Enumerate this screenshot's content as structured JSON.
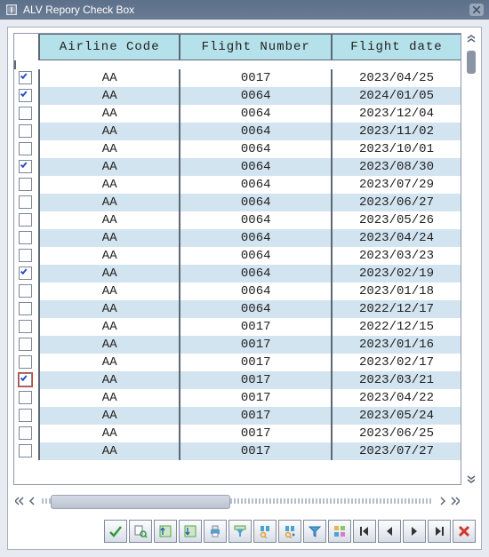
{
  "window": {
    "title": "ALV Repory Check Box"
  },
  "headers": {
    "airline": "Airline Code",
    "flight": "Flight Number",
    "date": "Flight date"
  },
  "rows": [
    {
      "checked": true,
      "focus": false,
      "airline": "AA",
      "flight": "0017",
      "date": "2023/04/25"
    },
    {
      "checked": true,
      "focus": false,
      "airline": "AA",
      "flight": "0064",
      "date": "2024/01/05"
    },
    {
      "checked": false,
      "focus": false,
      "airline": "AA",
      "flight": "0064",
      "date": "2023/12/04"
    },
    {
      "checked": false,
      "focus": false,
      "airline": "AA",
      "flight": "0064",
      "date": "2023/11/02"
    },
    {
      "checked": false,
      "focus": false,
      "airline": "AA",
      "flight": "0064",
      "date": "2023/10/01"
    },
    {
      "checked": true,
      "focus": false,
      "airline": "AA",
      "flight": "0064",
      "date": "2023/08/30"
    },
    {
      "checked": false,
      "focus": false,
      "airline": "AA",
      "flight": "0064",
      "date": "2023/07/29"
    },
    {
      "checked": false,
      "focus": false,
      "airline": "AA",
      "flight": "0064",
      "date": "2023/06/27"
    },
    {
      "checked": false,
      "focus": false,
      "airline": "AA",
      "flight": "0064",
      "date": "2023/05/26"
    },
    {
      "checked": false,
      "focus": false,
      "airline": "AA",
      "flight": "0064",
      "date": "2023/04/24"
    },
    {
      "checked": false,
      "focus": false,
      "airline": "AA",
      "flight": "0064",
      "date": "2023/03/23"
    },
    {
      "checked": true,
      "focus": false,
      "airline": "AA",
      "flight": "0064",
      "date": "2023/02/19"
    },
    {
      "checked": false,
      "focus": false,
      "airline": "AA",
      "flight": "0064",
      "date": "2023/01/18"
    },
    {
      "checked": false,
      "focus": false,
      "airline": "AA",
      "flight": "0064",
      "date": "2022/12/17"
    },
    {
      "checked": false,
      "focus": false,
      "airline": "AA",
      "flight": "0017",
      "date": "2022/12/15"
    },
    {
      "checked": false,
      "focus": false,
      "airline": "AA",
      "flight": "0017",
      "date": "2023/01/16"
    },
    {
      "checked": false,
      "focus": false,
      "airline": "AA",
      "flight": "0017",
      "date": "2023/02/17"
    },
    {
      "checked": true,
      "focus": true,
      "airline": "AA",
      "flight": "0017",
      "date": "2023/03/21"
    },
    {
      "checked": false,
      "focus": false,
      "airline": "AA",
      "flight": "0017",
      "date": "2023/04/22"
    },
    {
      "checked": false,
      "focus": false,
      "airline": "AA",
      "flight": "0017",
      "date": "2023/05/24"
    },
    {
      "checked": false,
      "focus": false,
      "airline": "AA",
      "flight": "0017",
      "date": "2023/06/25"
    },
    {
      "checked": false,
      "focus": false,
      "airline": "AA",
      "flight": "0017",
      "date": "2023/07/27"
    }
  ],
  "toolbar": [
    {
      "name": "accept-icon"
    },
    {
      "name": "details-icon"
    },
    {
      "name": "sort-asc-icon"
    },
    {
      "name": "sort-desc-icon"
    },
    {
      "name": "print-icon"
    },
    {
      "name": "filter-set-icon"
    },
    {
      "name": "find-icon"
    },
    {
      "name": "find-next-icon"
    },
    {
      "name": "filter-icon"
    },
    {
      "name": "layout-icon"
    },
    {
      "name": "first-page-icon"
    },
    {
      "name": "prev-page-icon"
    },
    {
      "name": "next-page-icon"
    },
    {
      "name": "last-page-icon"
    },
    {
      "name": "cancel-icon"
    }
  ]
}
